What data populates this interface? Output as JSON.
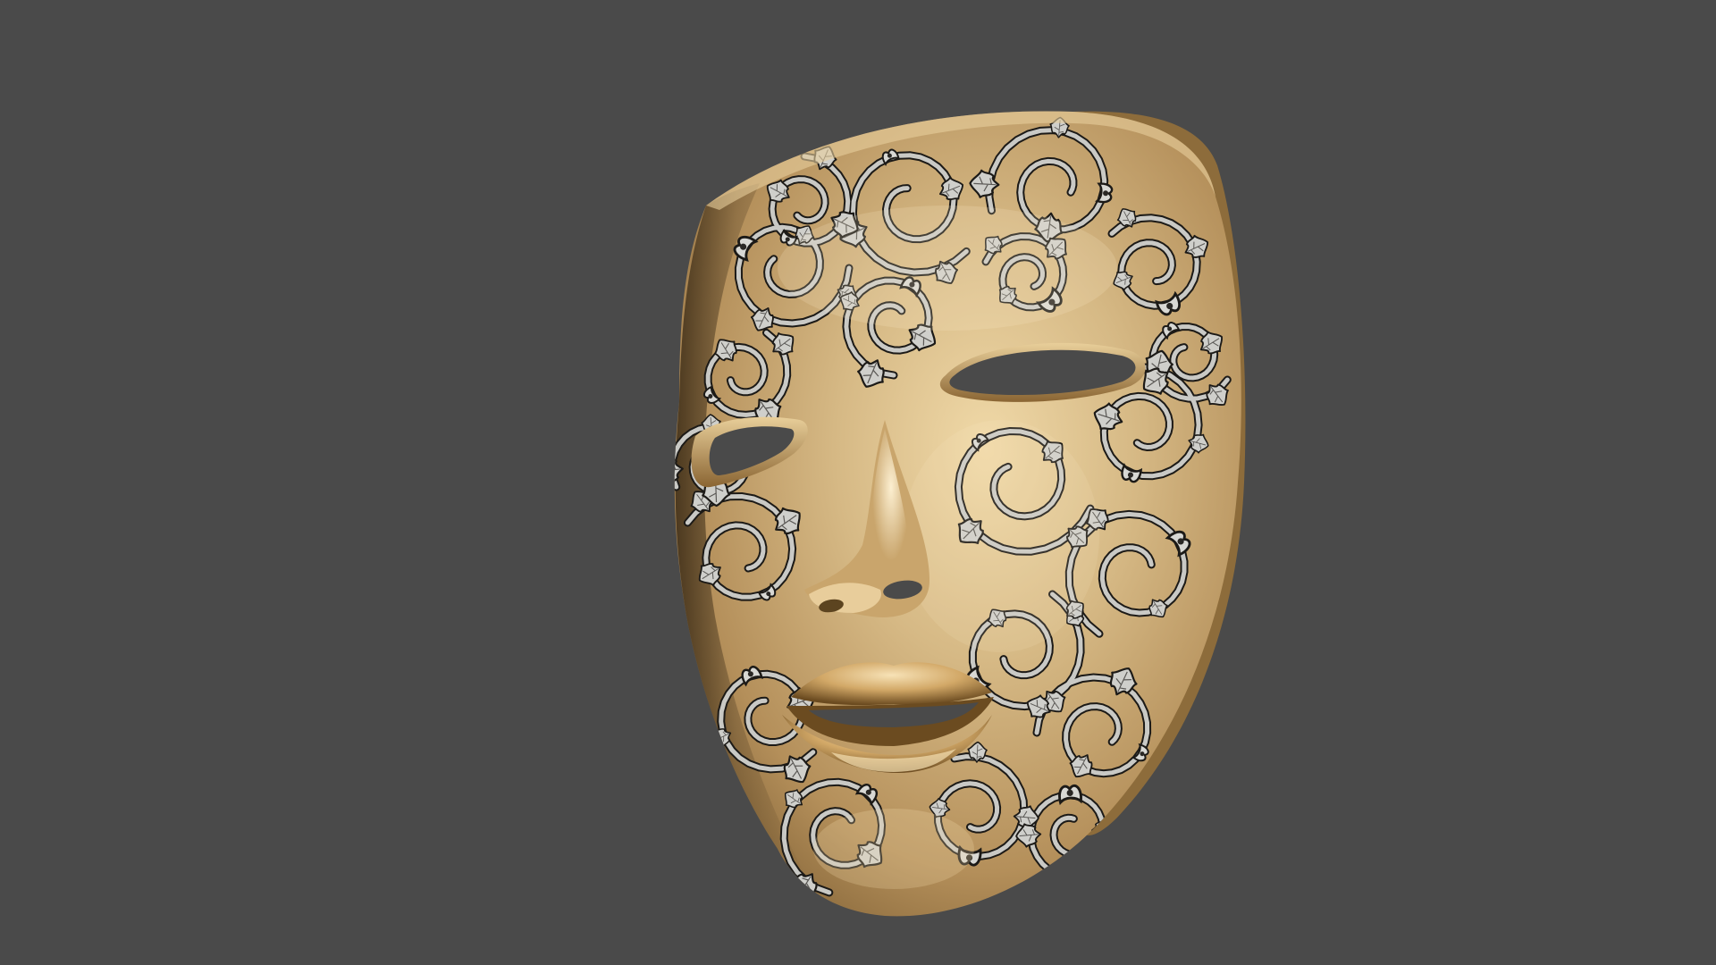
{
  "scene": {
    "background_color": "#4a4a4a",
    "subject": "venetian-face-mask",
    "material_colors": {
      "gold_highlight": "#f4dfb2",
      "gold_light": "#d9bf8b",
      "gold_mid": "#b6925c",
      "gold_dark": "#6e5128",
      "gold_deep": "#3b2a14",
      "inlay_silver": "#c8c8c4",
      "inlay_silver_light": "#e6e6e2",
      "inlay_outline": "#1c1a17"
    },
    "ornament": "silver-vine-and-leaf-filigree"
  }
}
